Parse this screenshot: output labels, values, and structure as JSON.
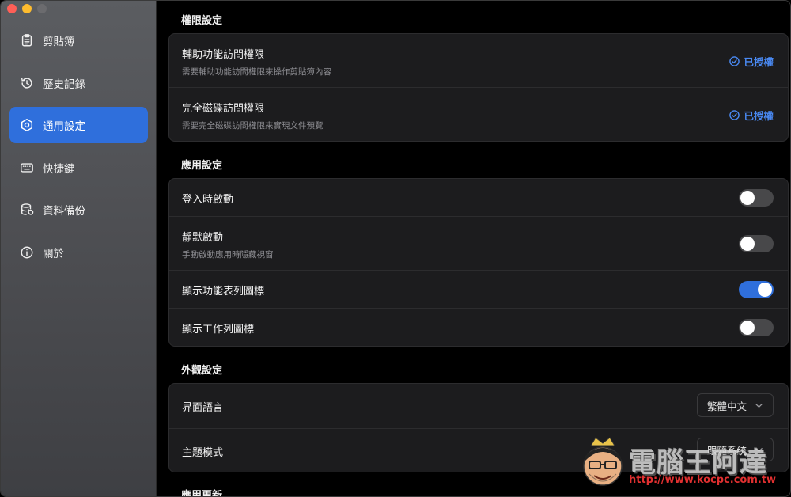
{
  "sidebar": {
    "items": [
      {
        "label": "剪貼簿",
        "icon": "clipboard-icon",
        "active": false
      },
      {
        "label": "歷史記錄",
        "icon": "history-icon",
        "active": false
      },
      {
        "label": "通用設定",
        "icon": "settings-hexagon-icon",
        "active": true
      },
      {
        "label": "快捷鍵",
        "icon": "keyboard-icon",
        "active": false
      },
      {
        "label": "資料備份",
        "icon": "database-backup-icon",
        "active": false
      },
      {
        "label": "關於",
        "icon": "info-icon",
        "active": false
      }
    ]
  },
  "permissions": {
    "title": "權限設定",
    "rows": [
      {
        "title": "輔助功能訪問權限",
        "desc": "需要輔助功能訪問權限來操作剪貼簿內容",
        "status": "已授權"
      },
      {
        "title": "完全磁碟訪問權限",
        "desc": "需要完全磁碟訪問權限來實現文件預覽",
        "status": "已授權"
      }
    ]
  },
  "app_settings": {
    "title": "應用設定",
    "rows": [
      {
        "title": "登入時啟動",
        "desc": "",
        "on": false
      },
      {
        "title": "靜默啟動",
        "desc": "手動啟動應用時隱藏視窗",
        "on": false
      },
      {
        "title": "顯示功能表列圖標",
        "desc": "",
        "on": true
      },
      {
        "title": "顯示工作列圖標",
        "desc": "",
        "on": false
      }
    ]
  },
  "appearance": {
    "title": "外觀設定",
    "rows": [
      {
        "title": "界面語言",
        "value": "繁體中文"
      },
      {
        "title": "主題模式",
        "value": "跟隨系統"
      }
    ]
  },
  "update": {
    "title": "應用更新"
  },
  "watermark": {
    "text": "電腦王阿達",
    "url": "http://www.kocpc.com.tw"
  },
  "colors": {
    "accent": "#2f6fdc",
    "granted": "#4a8af4",
    "card": "#1c1c1e"
  }
}
